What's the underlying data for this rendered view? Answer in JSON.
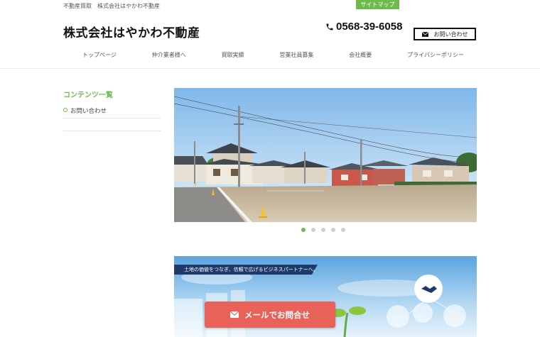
{
  "header": {
    "tagline": "不動産買取　株式会社はやかわ不動産",
    "sitemap_label": "サイトマップ",
    "logo_text": "株式会社はやかわ不動産",
    "phone": "0568-39-6058",
    "contact_label": "お問い合わせ"
  },
  "nav": {
    "items": [
      {
        "label": "トップページ"
      },
      {
        "label": "仲介業者様へ"
      },
      {
        "label": "買取実績"
      },
      {
        "label": "営業社員募集"
      },
      {
        "label": "会社概要"
      },
      {
        "label": "プライバシーポリシー"
      }
    ]
  },
  "sidebar": {
    "title": "コンテンツ一覧",
    "items": [
      {
        "label": "お問い合わせ"
      }
    ]
  },
  "slider": {
    "total_slides": 5,
    "active_index": 0
  },
  "banner": {
    "caption": "土地の価値をつなぎ、信頼で広げるビジネスパートナーへ。"
  },
  "cta": {
    "mail_label": "メールでお問合せ"
  },
  "colors": {
    "accent_green": "#6dbb4c",
    "cta_red": "#e8625a",
    "banner_ribbon": "#1e3a6b"
  }
}
